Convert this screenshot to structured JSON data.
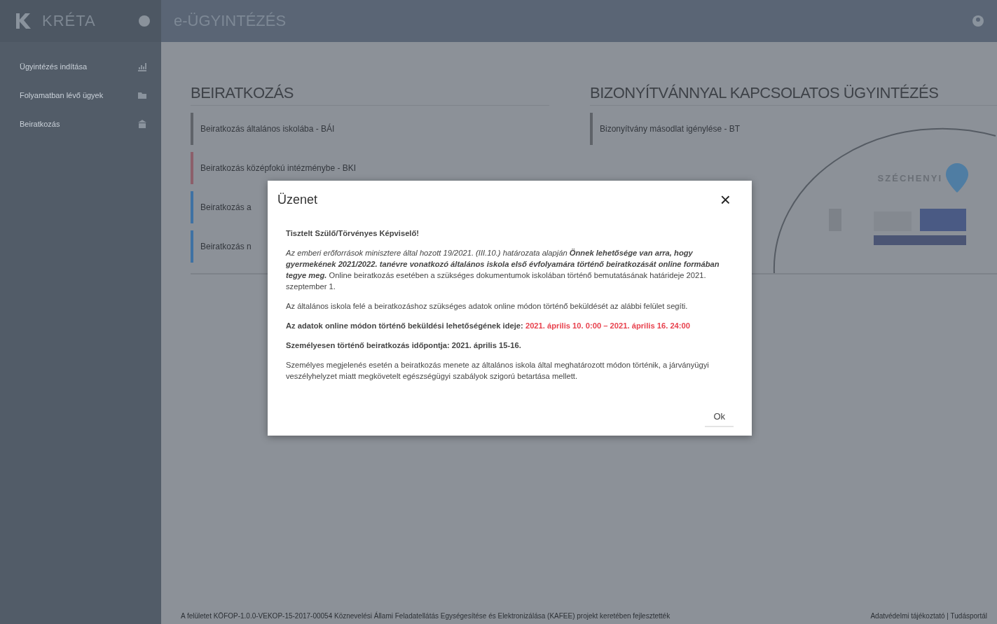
{
  "sidebar": {
    "brand": "KRÉTA",
    "items": [
      {
        "label": "Ügyintézés indítása"
      },
      {
        "label": "Folyamatban lévő ügyek"
      },
      {
        "label": "Beiratkozás"
      }
    ]
  },
  "header": {
    "title": "e-ÜGYINTÉZÉS"
  },
  "sections": [
    {
      "title": "BEIRATKOZÁS",
      "items": [
        {
          "label": "Beiratkozás általános iskolába - BÁI",
          "color": "#5f6369"
        },
        {
          "label": "Beiratkozás középfokú intézménybe - BKI",
          "color": "#8c5f6a"
        },
        {
          "label": "Beiratkozás a",
          "color": "#3f72a3"
        },
        {
          "label": "Beiratkozás n",
          "color": "#3f72a3"
        }
      ]
    },
    {
      "title": "BIZONYÍTVÁNNYAL KAPCSOLATOS ÜGYINTÉZÉS",
      "items": [
        {
          "label": "Bizonyítvány másodlat igénylése - BT",
          "color": "#5f6369"
        }
      ]
    }
  ],
  "logo": {
    "name": "SZÉCHENYI"
  },
  "footer": {
    "left": "A felületet KÖFOP-1.0.0-VEKOP-15-2017-00054 Köznevelési Állami Feladatellátás Egységesítése és Elektronizálása (KAFEE) projekt keretében fejlesztették",
    "right": "Adatvédelmi tájékoztató | Tudásportál"
  },
  "dialog": {
    "title": "Üzenet",
    "close": "×",
    "paragraphs": [
      [
        {
          "text": "Tisztelt Szülő/Törvényes Képviselő!",
          "kind": "bold"
        }
      ],
      [
        {
          "text": "Az emberi erőforrások minisztere által hozott 19/2021. (III.10.) határozata alapján ",
          "kind": "italic"
        },
        {
          "text": "Önnek lehetősége van arra, hogy gyermekének 2021/2022. tanévre vonatkozó általános iskola első évfolyamára történő beiratkozását online formában tegye meg.",
          "kind": "emphasis"
        },
        {
          "text": " Online beiratkozás esetében a szükséges dokumentumok iskolában történő bemutatásának határideje 2021. szeptember 1.",
          "kind": "plain"
        }
      ],
      [
        {
          "text": "Az általános iskola felé a beiratkozáshoz szükséges adatok online módon történő beküldését az alábbi felület segíti.",
          "kind": "plain"
        }
      ],
      [
        {
          "text": "Az adatok online módon történő beküldési lehetőségének ideje: ",
          "kind": "bold"
        },
        {
          "text": "2021. április 10. 0:00 – 2021. április 16. 24:00",
          "kind": "highlight"
        }
      ],
      [
        {
          "text": "Személyesen történő beiratkozás időpontja: 2021. április 15-16.",
          "kind": "bold"
        }
      ],
      [
        {
          "text": "Személyes megjelenés esetén a beiratkozás menete az általános iskola által meghatározott módon történik, a járványügyi veszélyhelyzet miatt megkövetelt egészségügyi szabályok szigorú betartása mellett.",
          "kind": "plain"
        }
      ]
    ],
    "ok": "Ok"
  }
}
